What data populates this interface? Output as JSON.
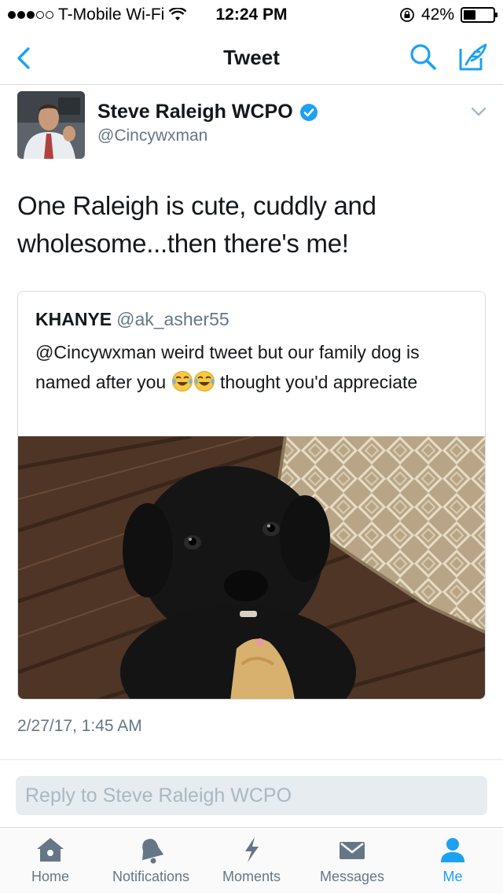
{
  "status_bar": {
    "carrier": "T-Mobile Wi-Fi",
    "time": "12:24 PM",
    "battery": "42%",
    "battery_level": 0.42
  },
  "nav": {
    "title": "Tweet",
    "icons": [
      "back-chevron-icon",
      "search-icon",
      "compose-icon"
    ]
  },
  "tweet": {
    "author_name": "Steve Raleigh WCPO",
    "handle": "@Cincywxman",
    "verified": true,
    "text": "One Raleigh is cute, cuddly and wholesome...then there's me!",
    "timestamp": "2/27/17, 1:45 AM"
  },
  "quoted": {
    "name": "KHANYE",
    "handle": "@ak_asher55",
    "text_before": "@Cincywxman weird tweet but our family dog is named after you ",
    "emoji": "tears-of-joy-emoji",
    "text_after": " thought you'd appreciate"
  },
  "reply": {
    "placeholder": "Reply to Steve Raleigh WCPO"
  },
  "tabs": [
    {
      "label": "Home",
      "icon": "home-icon"
    },
    {
      "label": "Notifications",
      "icon": "bell-icon"
    },
    {
      "label": "Moments",
      "icon": "lightning-icon"
    },
    {
      "label": "Messages",
      "icon": "envelope-icon"
    },
    {
      "label": "Me",
      "icon": "person-icon",
      "active": true
    }
  ],
  "colors": {
    "accent": "#1da1f2",
    "text": "#14171a",
    "secondary": "#657786"
  }
}
